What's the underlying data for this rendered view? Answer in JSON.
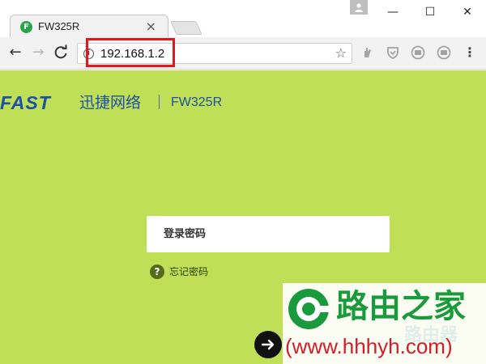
{
  "browser": {
    "tab_favicon_letter": "F",
    "tab_title": "FW325R",
    "tab_close_icon": "×",
    "window_controls": {
      "minimize": "—",
      "maximize": "☐",
      "close": "✕"
    },
    "nav": {
      "back": "←",
      "forward": "→",
      "reload": "C"
    },
    "address_info_icon": "i",
    "address_url": "192.168.1.2",
    "bookmark_star_icon": "☆",
    "extension_icons": [
      "hand-icon",
      "shield-icon",
      "circle-icon-1",
      "circle-icon-2"
    ],
    "menu_icon": "⋮",
    "highlight_color": "#e0191e"
  },
  "page": {
    "background_color": "#bedf56",
    "brand": {
      "logo": "FAST",
      "name_cn": "迅捷网络",
      "separator": "|",
      "model": "FW325R"
    },
    "login": {
      "password_placeholder": "登录密码"
    },
    "forgot": {
      "icon": "?",
      "label": "忘记密码"
    },
    "submit_icon": "arrow-right-icon"
  },
  "watermark": {
    "title": "路由之家",
    "url": "(www.hhhyh.com)",
    "ghost": "路由器"
  }
}
